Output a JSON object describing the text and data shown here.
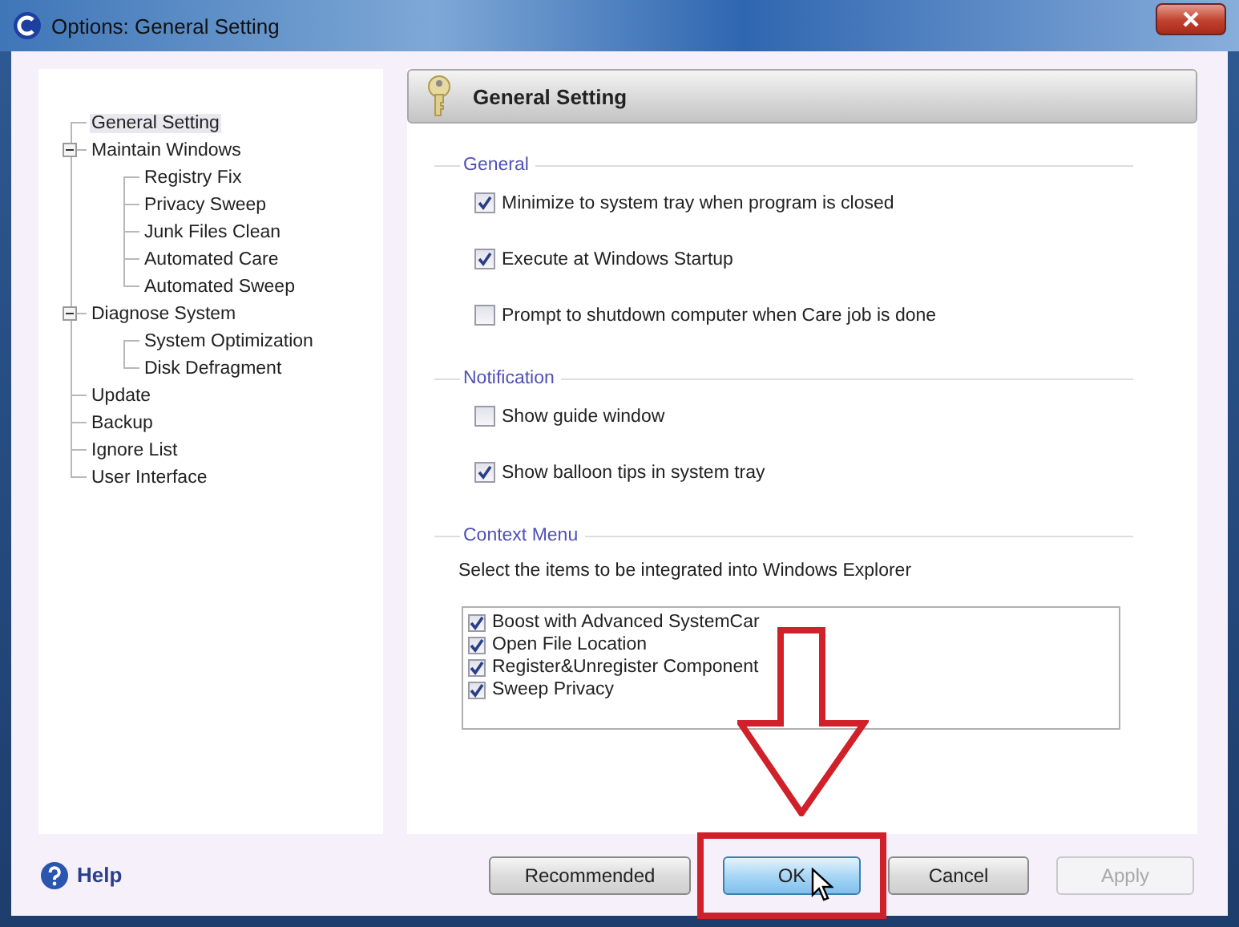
{
  "window": {
    "title": "Options: General Setting"
  },
  "tree": [
    {
      "label": "General Setting",
      "selected": true
    },
    {
      "label": "Maintain Windows",
      "selected": false,
      "expanded": true,
      "children": [
        {
          "label": "Registry Fix",
          "selected": false
        },
        {
          "label": "Privacy Sweep",
          "selected": false
        },
        {
          "label": "Junk Files Clean",
          "selected": false
        },
        {
          "label": "Automated Care",
          "selected": false
        },
        {
          "label": "Automated Sweep",
          "selected": false
        }
      ]
    },
    {
      "label": "Diagnose System",
      "selected": false,
      "expanded": true,
      "children": [
        {
          "label": "System Optimization",
          "selected": false
        },
        {
          "label": "Disk Defragment",
          "selected": false
        }
      ]
    },
    {
      "label": "Update",
      "selected": false
    },
    {
      "label": "Backup",
      "selected": false
    },
    {
      "label": "Ignore List",
      "selected": false
    },
    {
      "label": "User Interface",
      "selected": false
    }
  ],
  "panel": {
    "title": "General Setting"
  },
  "sections": [
    {
      "title": "General",
      "options": [
        {
          "label": "Minimize to system tray when program is closed",
          "checked": true
        },
        {
          "label": "Execute at Windows Startup",
          "checked": true
        },
        {
          "label": "Prompt to shutdown computer when Care job is done",
          "checked": false
        }
      ]
    },
    {
      "title": "Notification",
      "options": [
        {
          "label": "Show guide window",
          "checked": false
        },
        {
          "label": "Show balloon tips in system tray",
          "checked": true
        }
      ]
    },
    {
      "title": "Context Menu",
      "description": "Select the items to be integrated into Windows Explorer",
      "list": [
        {
          "label": "Boost with Advanced SystemCar",
          "checked": true
        },
        {
          "label": "Open File Location",
          "checked": true
        },
        {
          "label": "Register&Unregister Component",
          "checked": true
        },
        {
          "label": "Sweep Privacy",
          "checked": true
        }
      ]
    }
  ],
  "help": {
    "label": "Help"
  },
  "buttons": [
    {
      "label": "Recommended",
      "focused": false,
      "disabled": false
    },
    {
      "label": "OK",
      "focused": true,
      "disabled": false
    },
    {
      "label": "Cancel",
      "focused": false,
      "disabled": false
    },
    {
      "label": "Apply",
      "focused": false,
      "disabled": true
    }
  ]
}
